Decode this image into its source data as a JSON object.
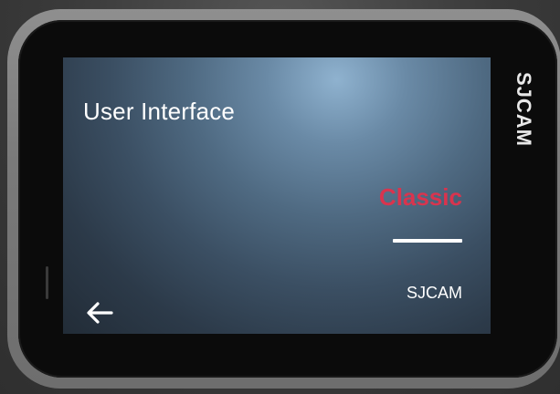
{
  "device": {
    "brand_logo": "SJCAM"
  },
  "screen": {
    "title": "User Interface",
    "options": [
      {
        "label": "Classic",
        "selected": true,
        "color": "#d9344e"
      },
      {
        "label": "SJCAM",
        "selected": false,
        "color": "#ffffff"
      }
    ],
    "back_icon": "arrow-left-icon"
  }
}
